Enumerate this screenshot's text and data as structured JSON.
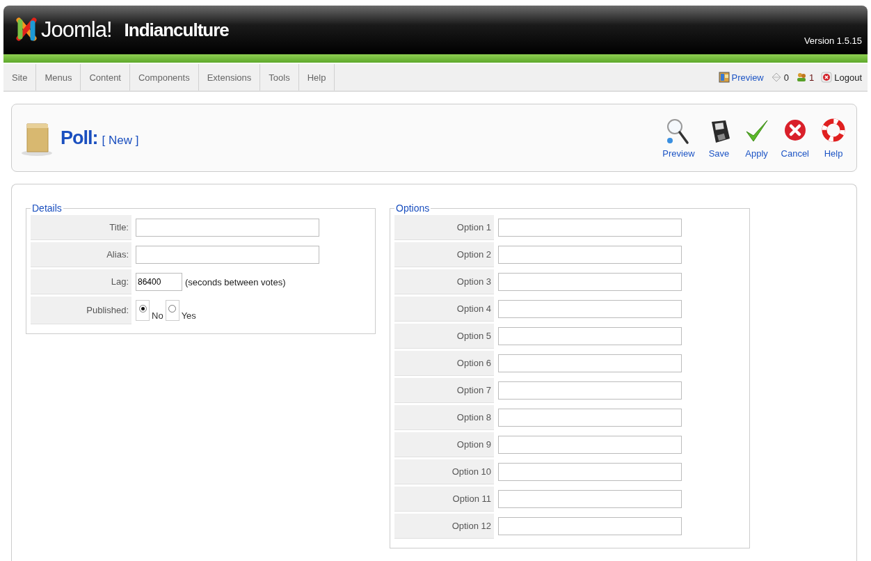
{
  "header": {
    "logo_text": "Joomla!",
    "site_name": "Indianculture",
    "version": "Version 1.5.15"
  },
  "menu": [
    {
      "label": "Site"
    },
    {
      "label": "Menus"
    },
    {
      "label": "Content"
    },
    {
      "label": "Components"
    },
    {
      "label": "Extensions"
    },
    {
      "label": "Tools"
    },
    {
      "label": "Help"
    }
  ],
  "status": [
    {
      "kind": "preview",
      "label": "Preview"
    },
    {
      "kind": "messages",
      "label": "0"
    },
    {
      "kind": "users",
      "label": "1"
    },
    {
      "kind": "logout",
      "label": "Logout"
    }
  ],
  "page_title": {
    "title": "Poll:",
    "subtitle": "[ New ]"
  },
  "toolbar": [
    {
      "kind": "preview",
      "label": "Preview"
    },
    {
      "kind": "save",
      "label": "Save"
    },
    {
      "kind": "apply",
      "label": "Apply"
    },
    {
      "kind": "cancel",
      "label": "Cancel"
    },
    {
      "kind": "help",
      "label": "Help"
    }
  ],
  "details": {
    "legend": "Details",
    "fields": [
      {
        "kind": "text",
        "label": "Title:"
      },
      {
        "kind": "text",
        "label": "Alias:"
      },
      {
        "kind": "short",
        "label": "Lag:",
        "value": "86400",
        "note": "(seconds between votes)"
      },
      {
        "kind": "radio",
        "label": "Published:",
        "options": [
          {
            "label": "No",
            "selected": true
          },
          {
            "label": "Yes",
            "selected": false
          }
        ]
      }
    ]
  },
  "options": {
    "legend": "Options",
    "items": [
      {
        "label": "Option 1"
      },
      {
        "label": "Option 2"
      },
      {
        "label": "Option 3"
      },
      {
        "label": "Option 4"
      },
      {
        "label": "Option 5"
      },
      {
        "label": "Option 6"
      },
      {
        "label": "Option 7"
      },
      {
        "label": "Option 8"
      },
      {
        "label": "Option 9"
      },
      {
        "label": "Option 10"
      },
      {
        "label": "Option 11"
      },
      {
        "label": "Option 12"
      }
    ]
  }
}
